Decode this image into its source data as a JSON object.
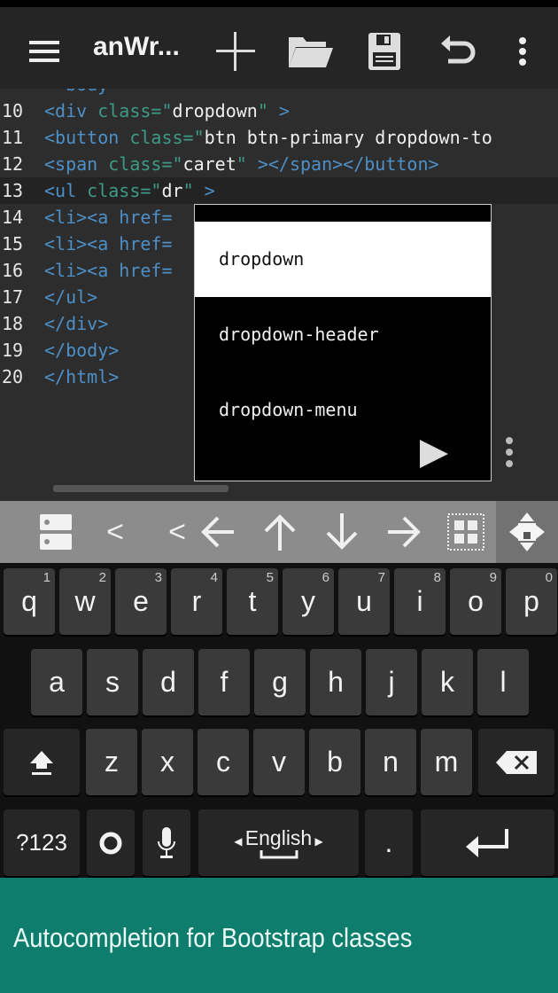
{
  "app": {
    "title": "anWr...",
    "icons": [
      "menu-icon",
      "add-icon",
      "folder-open-icon",
      "save-icon",
      "undo-icon",
      "more-vert-icon"
    ]
  },
  "editor": {
    "lines": [
      {
        "n": "",
        "parts": [
          [
            "tag",
            "  body"
          ]
        ]
      },
      {
        "n": "10",
        "parts": [
          [
            "tag",
            "<div "
          ],
          [
            "attr",
            "class="
          ],
          [
            "attr",
            "\""
          ],
          [
            "str",
            "dropdown"
          ],
          [
            "attr",
            "\""
          ],
          [
            "tag",
            " >"
          ]
        ]
      },
      {
        "n": "11",
        "parts": [
          [
            "tag",
            "<button "
          ],
          [
            "attr",
            "class="
          ],
          [
            "attr",
            "\""
          ],
          [
            "str",
            "btn btn-primary dropdown-to"
          ]
        ]
      },
      {
        "n": "12",
        "parts": [
          [
            "tag",
            "<span "
          ],
          [
            "attr",
            "class="
          ],
          [
            "attr",
            "\""
          ],
          [
            "str",
            "caret"
          ],
          [
            "attr",
            "\""
          ],
          [
            "tag",
            " ></span></button>"
          ]
        ]
      },
      {
        "n": "13",
        "parts": [
          [
            "tag",
            "<ul "
          ],
          [
            "attr",
            "class=\""
          ],
          [
            "str",
            "dr"
          ],
          [
            "attr",
            "\""
          ],
          [
            "tag",
            " >"
          ]
        ]
      },
      {
        "n": "14",
        "parts": [
          [
            "tag",
            "<li><a href="
          ]
        ]
      },
      {
        "n": "15",
        "parts": [
          [
            "tag",
            "<li><a href="
          ]
        ]
      },
      {
        "n": "16",
        "parts": [
          [
            "tag",
            "<li><a href="
          ]
        ]
      },
      {
        "n": "17",
        "parts": [
          [
            "tag",
            "</ul>"
          ]
        ]
      },
      {
        "n": "18",
        "parts": [
          [
            "tag",
            "</div>"
          ]
        ]
      },
      {
        "n": "19",
        "parts": [
          [
            "tag",
            "</body>"
          ]
        ]
      },
      {
        "n": "20",
        "parts": [
          [
            "tag",
            "</html>"
          ]
        ]
      }
    ]
  },
  "autocomplete": {
    "items": [
      "dropdown",
      "dropdown-header",
      "dropdown-menu"
    ],
    "selected": 0
  },
  "helper_bar": {
    "keys": [
      "<",
      "<"
    ]
  },
  "keyboard": {
    "row1": [
      [
        "q",
        "1"
      ],
      [
        "w",
        "2"
      ],
      [
        "e",
        "3"
      ],
      [
        "r",
        "4"
      ],
      [
        "t",
        "5"
      ],
      [
        "y",
        "6"
      ],
      [
        "u",
        "7"
      ],
      [
        "i",
        "8"
      ],
      [
        "o",
        "9"
      ],
      [
        "p",
        "0"
      ]
    ],
    "row2": [
      "a",
      "s",
      "d",
      "f",
      "g",
      "h",
      "j",
      "k",
      "l"
    ],
    "row3": [
      "z",
      "x",
      "c",
      "v",
      "b",
      "n",
      "m"
    ],
    "symbols": "?123",
    "space": "English",
    "period": "."
  },
  "banner": {
    "text": "Autocompletion for Bootstrap classes"
  },
  "colors": {
    "tag": "#4d8fc7",
    "attr": "#3d9a86",
    "banner": "#0f7d6d"
  }
}
